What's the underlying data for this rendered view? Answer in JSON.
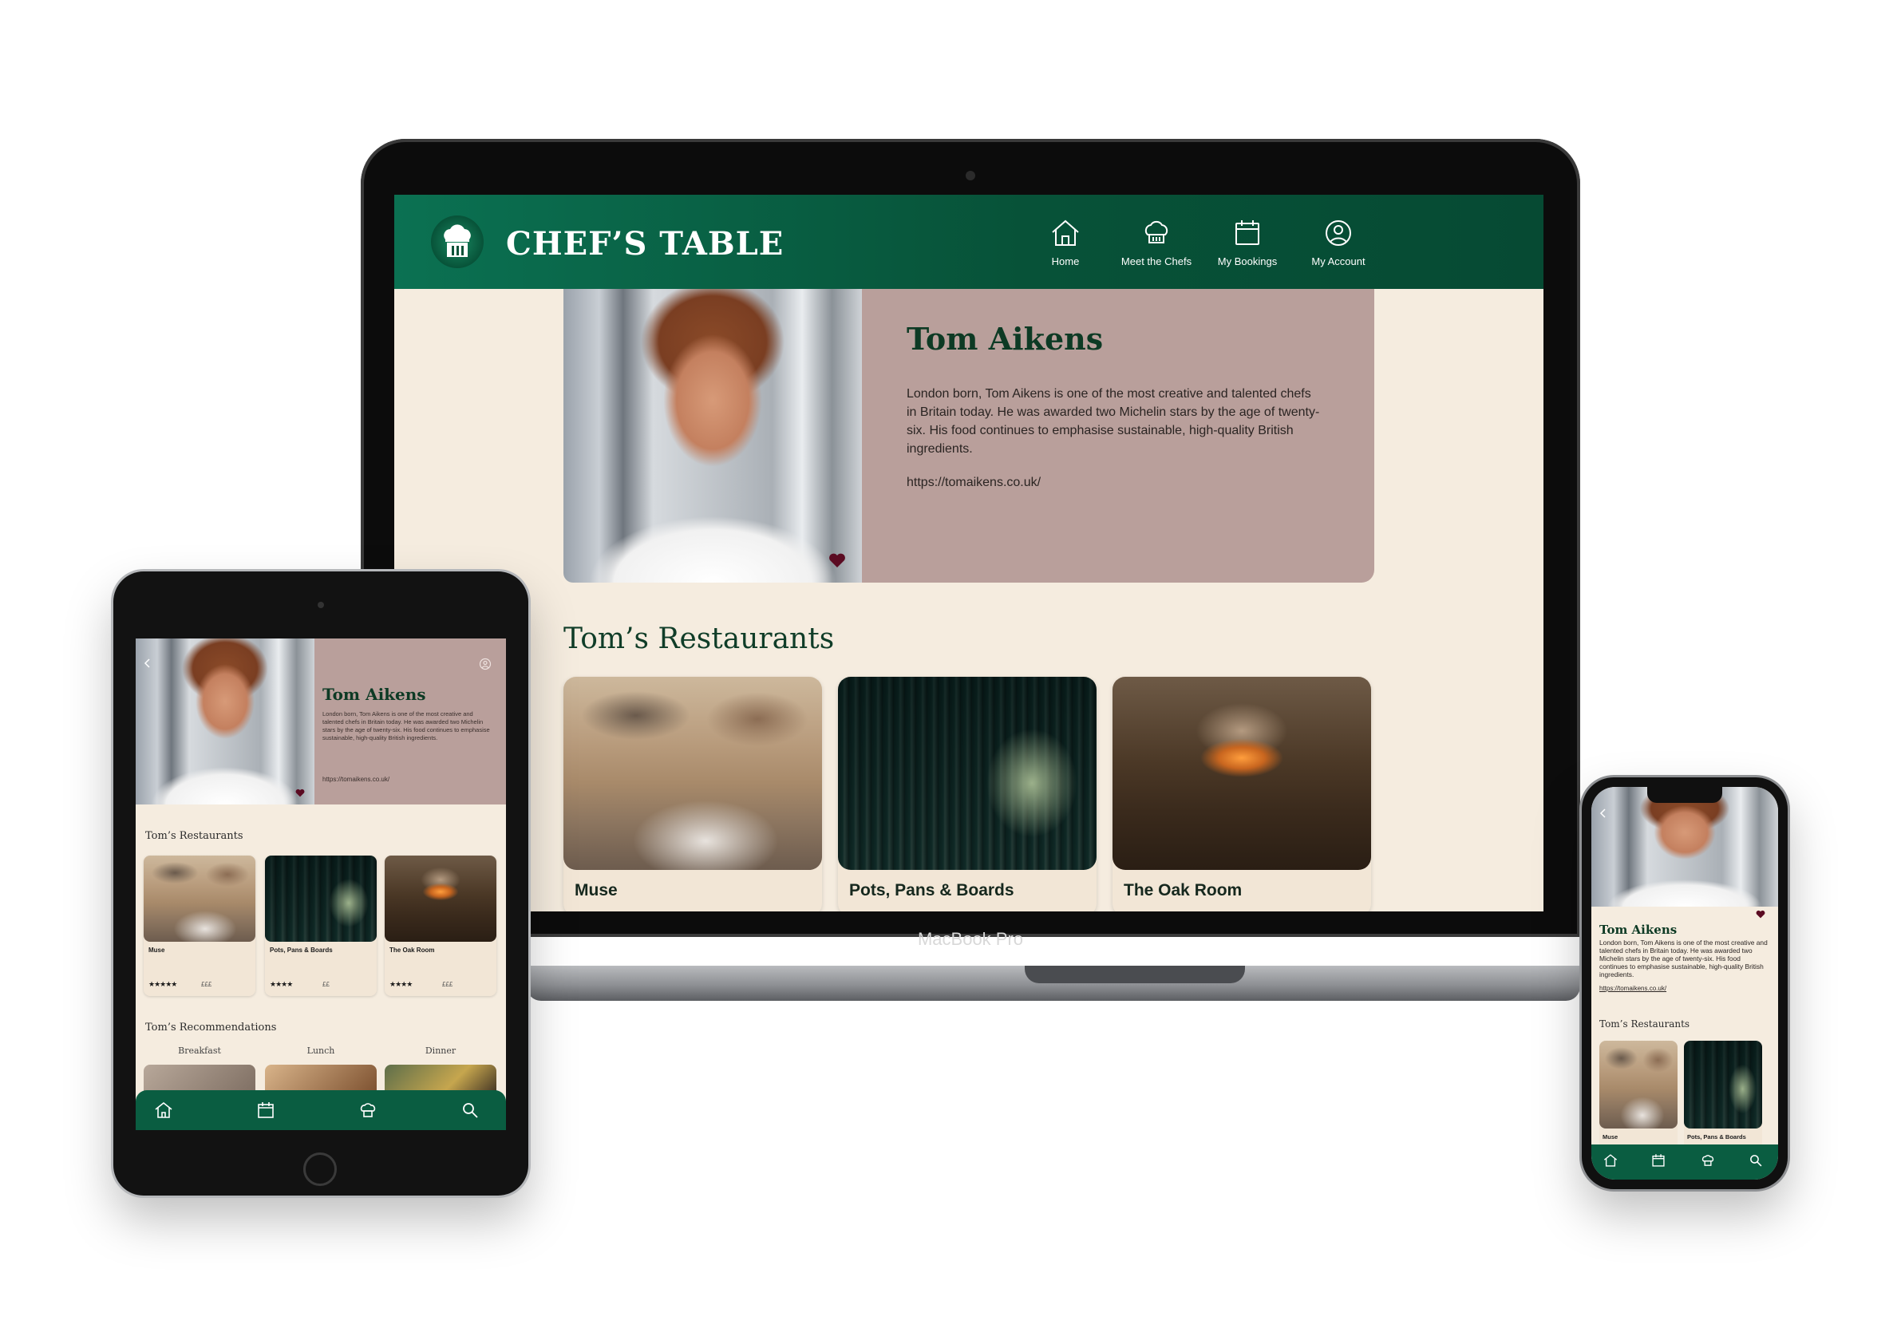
{
  "colors": {
    "brand_green": "#075238",
    "cream": "#f5ecdf",
    "mauve": "#b99f9b",
    "heart": "#5b0b22"
  },
  "laptop": {
    "device_label": "MacBook Pro",
    "app": {
      "brand": "CHEF’S TABLE",
      "nav": [
        {
          "label": "Home",
          "icon": "home-icon"
        },
        {
          "label": "Meet the Chefs",
          "icon": "chef-hat-icon"
        },
        {
          "label": "My Bookings",
          "icon": "calendar-icon"
        },
        {
          "label": "My Account",
          "icon": "account-icon"
        }
      ]
    },
    "chef": {
      "name": "Tom Aikens",
      "bio": "London born, Tom Aikens is one of the most creative and talented chefs in Britain today. He was awarded two Michelin stars by the age of twenty-six. His food continues to emphasise sustainable, high-quality British ingredients.",
      "url": "https://tomaikens.co.uk/"
    },
    "restaurants_title": "Tom’s Restaurants",
    "restaurants": [
      {
        "name": "Muse"
      },
      {
        "name": "Pots, Pans & Boards"
      },
      {
        "name": "The Oak Room"
      }
    ]
  },
  "tablet": {
    "chef_name": "Tom Aikens",
    "chef_bio": "London born, Tom Aikens is one of the most creative and talented chefs in Britain today. He was awarded two Michelin stars by the age of twenty-six. His food continues to emphasise sustainable, high-quality British ingredients.",
    "chef_url": "https://tomaikens.co.uk/",
    "restaurants_title": "Tom’s Restaurants",
    "restaurants": [
      {
        "name": "Muse",
        "stars": "★★★★★",
        "price": "£££"
      },
      {
        "name": "Pots, Pans & Boards",
        "stars": "★★★★",
        "price": "££"
      },
      {
        "name": "The Oak Room",
        "stars": "★★★★",
        "price": "£££"
      }
    ],
    "recommendations_title": "Tom’s Recommendations",
    "meals": [
      "Breakfast",
      "Lunch",
      "Dinner"
    ]
  },
  "phone": {
    "chef_name": "Tom Aikens",
    "chef_bio": "London born, Tom Aikens is one of the most creative and talented chefs in Britain today. He was awarded two Michelin stars by the age of twenty-six. His food continues to emphasise sustainable, high-quality British ingredients.",
    "chef_url": "https://tomaikens.co.uk/",
    "restaurants_title": "Tom’s Restaurants",
    "restaurants": [
      {
        "name": "Muse"
      },
      {
        "name": "Pots, Pans & Boards"
      }
    ]
  }
}
